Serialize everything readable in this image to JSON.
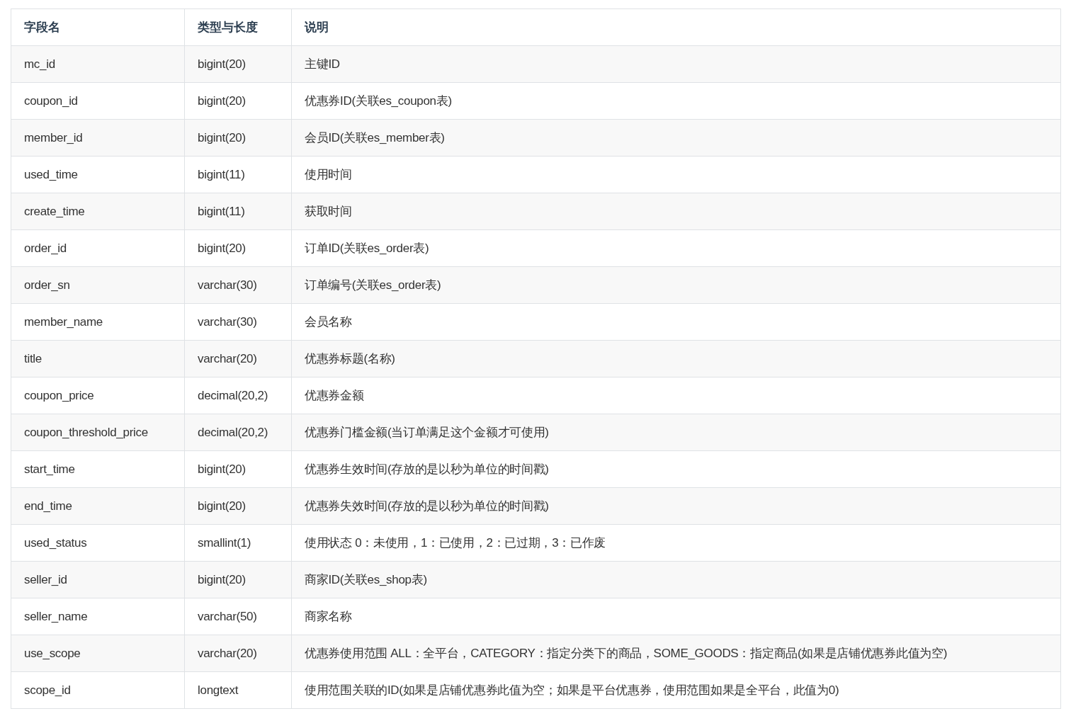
{
  "table": {
    "columns": [
      "字段名",
      "类型与长度",
      "说明"
    ],
    "rows": [
      [
        "mc_id",
        "bigint(20)",
        "主键ID"
      ],
      [
        "coupon_id",
        "bigint(20)",
        "优惠券ID(关联es_coupon表)"
      ],
      [
        "member_id",
        "bigint(20)",
        "会员ID(关联es_member表)"
      ],
      [
        "used_time",
        "bigint(11)",
        "使用时间"
      ],
      [
        "create_time",
        "bigint(11)",
        "获取时间"
      ],
      [
        "order_id",
        "bigint(20)",
        "订单ID(关联es_order表)"
      ],
      [
        "order_sn",
        "varchar(30)",
        "订单编号(关联es_order表)"
      ],
      [
        "member_name",
        "varchar(30)",
        "会员名称"
      ],
      [
        "title",
        "varchar(20)",
        "优惠券标题(名称)"
      ],
      [
        "coupon_price",
        "decimal(20,2)",
        "优惠券金额"
      ],
      [
        "coupon_threshold_price",
        "decimal(20,2)",
        "优惠券门槛金额(当订单满足这个金额才可使用)"
      ],
      [
        "start_time",
        "bigint(20)",
        "优惠券生效时间(存放的是以秒为单位的时间戳)"
      ],
      [
        "end_time",
        "bigint(20)",
        "优惠券失效时间(存放的是以秒为单位的时间戳)"
      ],
      [
        "used_status",
        "smallint(1)",
        "使用状态 0：未使用，1：已使用，2：已过期，3：已作废"
      ],
      [
        "seller_id",
        "bigint(20)",
        "商家ID(关联es_shop表)"
      ],
      [
        "seller_name",
        "varchar(50)",
        "商家名称"
      ],
      [
        "use_scope",
        "varchar(20)",
        "优惠券使用范围 ALL：全平台，CATEGORY：指定分类下的商品，SOME_GOODS：指定商品(如果是店铺优惠券此值为空)"
      ],
      [
        "scope_id",
        "longtext",
        "使用范围关联的ID(如果是店铺优惠券此值为空；如果是平台优惠券，使用范围如果是全平台，此值为0)"
      ]
    ]
  }
}
